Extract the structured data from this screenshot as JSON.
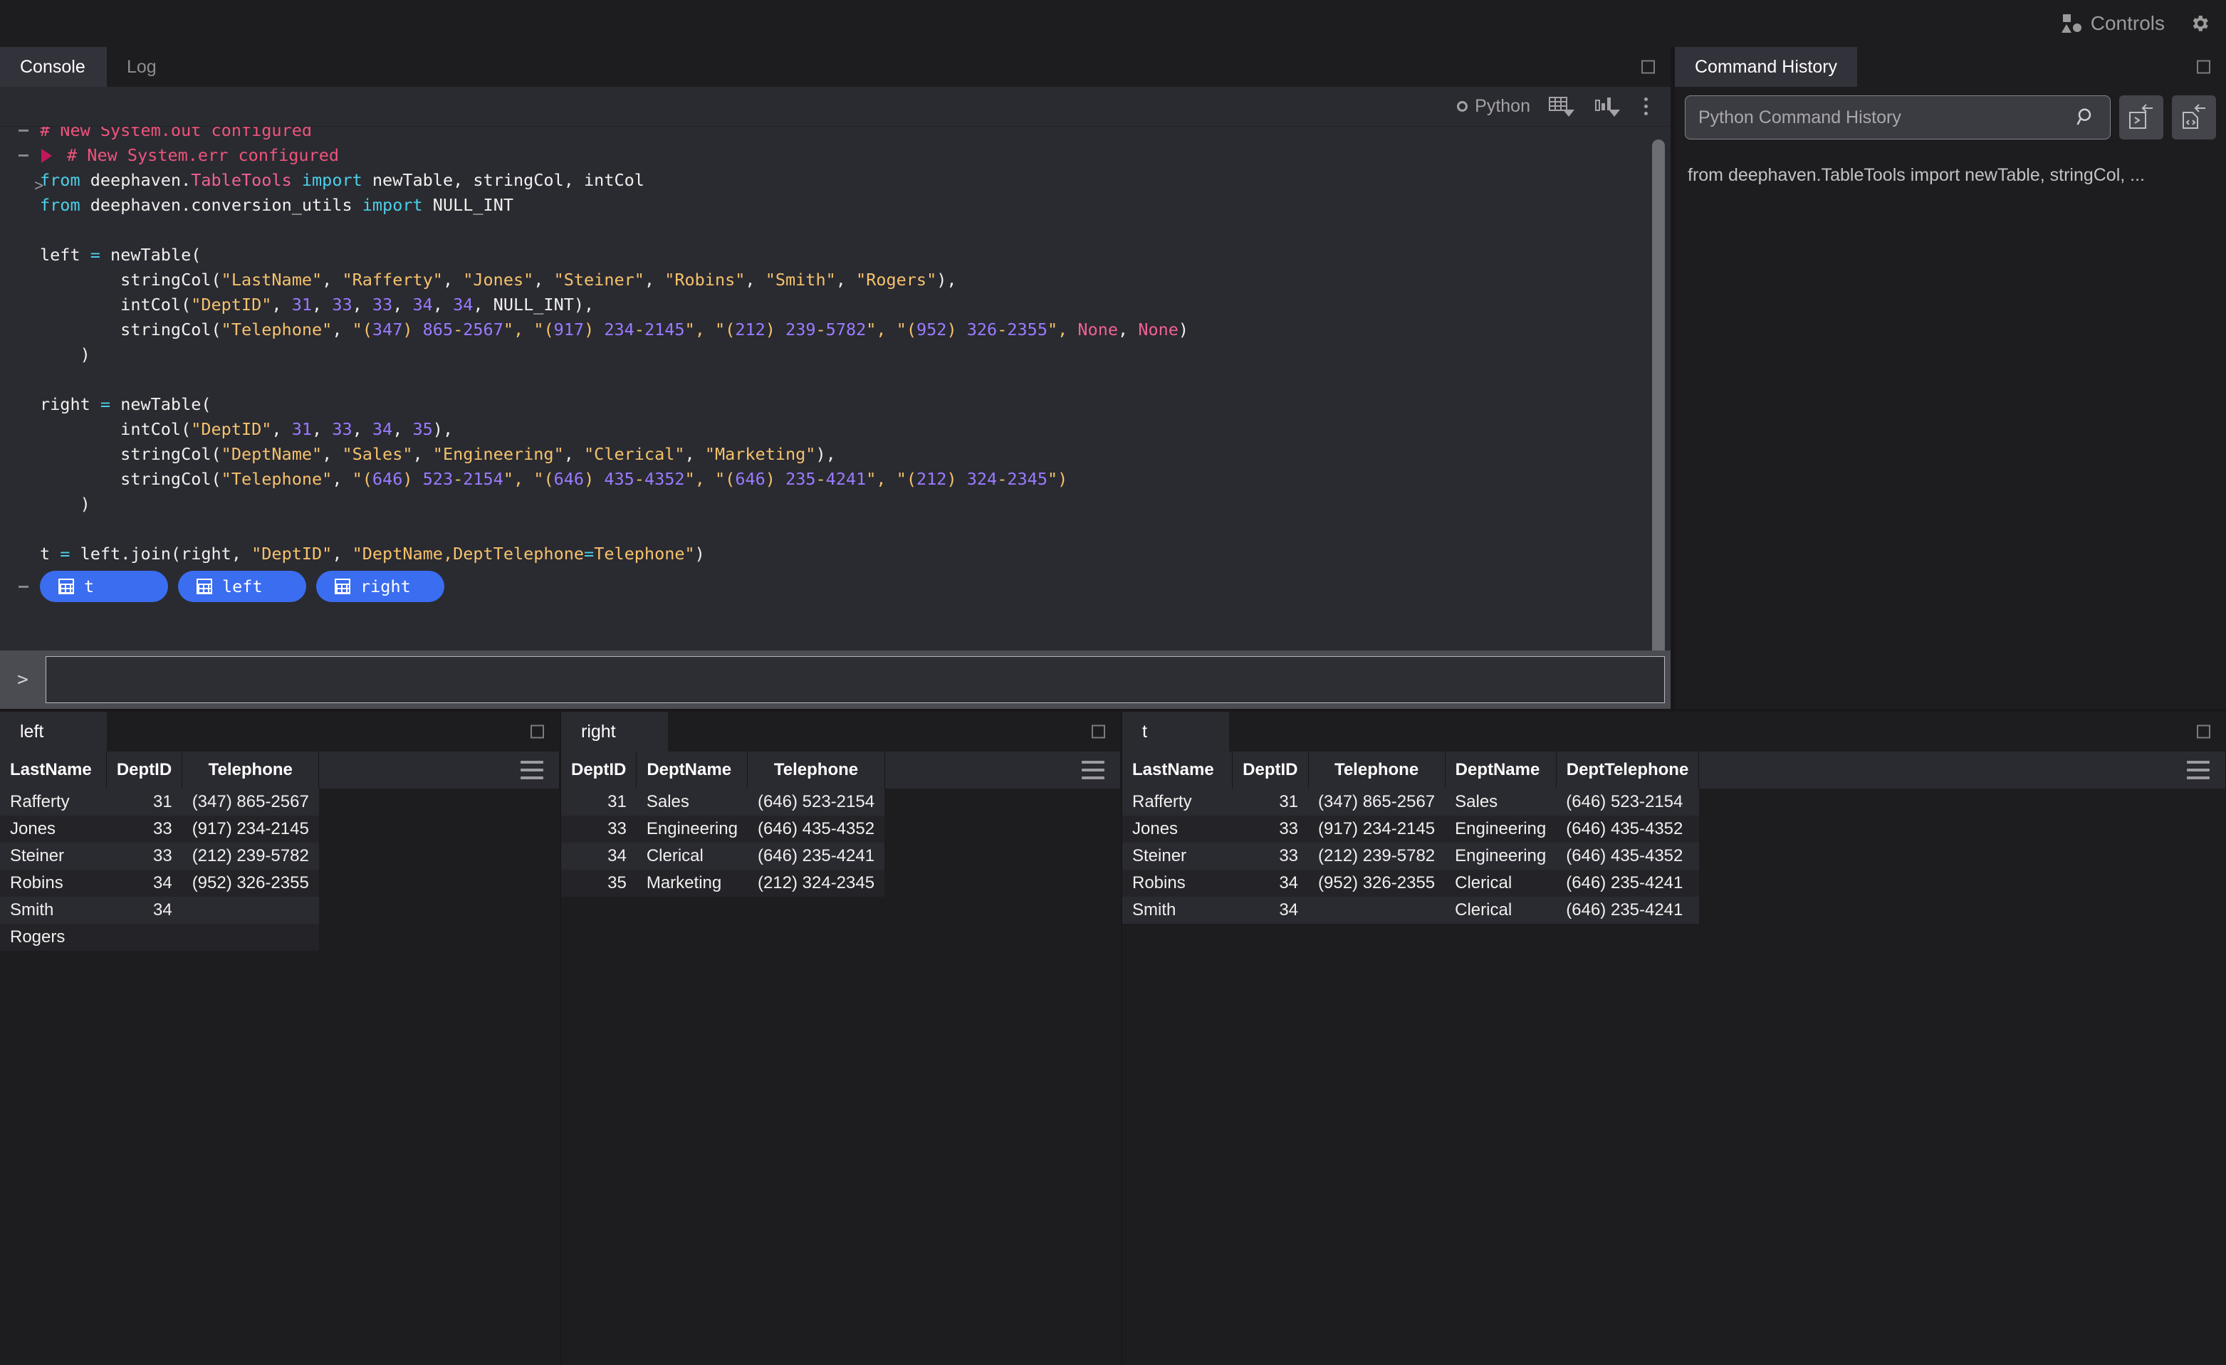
{
  "topbar": {
    "controls_label": "Controls",
    "settings_icon": "gear-icon"
  },
  "console_panel": {
    "tabs": [
      {
        "label": "Console",
        "active": true
      },
      {
        "label": "Log",
        "active": false
      }
    ],
    "toolbar": {
      "language": "Python",
      "table_icon": "table-dropdown-icon",
      "chart_icon": "chart-dropdown-icon",
      "overflow_icon": "kebab-menu-icon"
    },
    "log_lines": [
      {
        "gutter": "dash",
        "text": "# New System.out configured",
        "kind": "comment",
        "clipped": true
      },
      {
        "gutter": "dash-tri",
        "text": "# New System.err configured",
        "kind": "comment"
      },
      {
        "gutter": "chev",
        "kind": "code",
        "tokens": [
          {
            "t": "from ",
            "c": "kw"
          },
          {
            "t": "deephaven.",
            "c": "plain"
          },
          {
            "t": "TableTools",
            "c": "mod"
          },
          {
            "t": " ",
            "c": "plain"
          },
          {
            "t": "import",
            "c": "kw"
          },
          {
            "t": " newTable, stringCol, intCol",
            "c": "plain"
          }
        ]
      },
      {
        "gutter": "",
        "kind": "code",
        "tokens": [
          {
            "t": "from ",
            "c": "kw"
          },
          {
            "t": "deephaven.conversion_utils ",
            "c": "plain"
          },
          {
            "t": "import",
            "c": "kw"
          },
          {
            "t": " NULL_INT",
            "c": "plain"
          }
        ]
      },
      {
        "gutter": "",
        "kind": "blank",
        "tokens": []
      },
      {
        "gutter": "",
        "kind": "code",
        "tokens": [
          {
            "t": "left ",
            "c": "plain"
          },
          {
            "t": "=",
            "c": "op"
          },
          {
            "t": " newTable(",
            "c": "plain"
          }
        ]
      },
      {
        "gutter": "",
        "kind": "code",
        "tokens": [
          {
            "t": "        stringCol(",
            "c": "plain"
          },
          {
            "t": "\"LastName\"",
            "c": "str"
          },
          {
            "t": ", ",
            "c": "plain"
          },
          {
            "t": "\"Rafferty\"",
            "c": "str"
          },
          {
            "t": ", ",
            "c": "plain"
          },
          {
            "t": "\"Jones\"",
            "c": "str"
          },
          {
            "t": ", ",
            "c": "plain"
          },
          {
            "t": "\"Steiner\"",
            "c": "str"
          },
          {
            "t": ", ",
            "c": "plain"
          },
          {
            "t": "\"Robins\"",
            "c": "str"
          },
          {
            "t": ", ",
            "c": "plain"
          },
          {
            "t": "\"Smith\"",
            "c": "str"
          },
          {
            "t": ", ",
            "c": "plain"
          },
          {
            "t": "\"Rogers\"",
            "c": "str"
          },
          {
            "t": "),",
            "c": "plain"
          }
        ]
      },
      {
        "gutter": "",
        "kind": "code",
        "tokens": [
          {
            "t": "        intCol(",
            "c": "plain"
          },
          {
            "t": "\"DeptID\"",
            "c": "str"
          },
          {
            "t": ", ",
            "c": "plain"
          },
          {
            "t": "31",
            "c": "num"
          },
          {
            "t": ", ",
            "c": "plain"
          },
          {
            "t": "33",
            "c": "num"
          },
          {
            "t": ", ",
            "c": "plain"
          },
          {
            "t": "33",
            "c": "num"
          },
          {
            "t": ", ",
            "c": "plain"
          },
          {
            "t": "34",
            "c": "num"
          },
          {
            "t": ", ",
            "c": "plain"
          },
          {
            "t": "34",
            "c": "num"
          },
          {
            "t": ", NULL_INT),",
            "c": "plain"
          }
        ]
      },
      {
        "gutter": "",
        "kind": "code",
        "tokens": [
          {
            "t": "        stringCol(",
            "c": "plain"
          },
          {
            "t": "\"Telephone\"",
            "c": "str"
          },
          {
            "t": ", ",
            "c": "plain"
          },
          {
            "t": "\"(",
            "c": "str"
          },
          {
            "t": "347",
            "c": "num"
          },
          {
            "t": ") ",
            "c": "str"
          },
          {
            "t": "865",
            "c": "num"
          },
          {
            "t": "-",
            "c": "str"
          },
          {
            "t": "2567",
            "c": "num"
          },
          {
            "t": "\", ",
            "c": "str"
          },
          {
            "t": "\"(",
            "c": "str"
          },
          {
            "t": "917",
            "c": "num"
          },
          {
            "t": ") ",
            "c": "str"
          },
          {
            "t": "234",
            "c": "num"
          },
          {
            "t": "-",
            "c": "str"
          },
          {
            "t": "2145",
            "c": "num"
          },
          {
            "t": "\", ",
            "c": "str"
          },
          {
            "t": "\"(",
            "c": "str"
          },
          {
            "t": "212",
            "c": "num"
          },
          {
            "t": ") ",
            "c": "str"
          },
          {
            "t": "239",
            "c": "num"
          },
          {
            "t": "-",
            "c": "str"
          },
          {
            "t": "5782",
            "c": "num"
          },
          {
            "t": "\", ",
            "c": "str"
          },
          {
            "t": "\"(",
            "c": "str"
          },
          {
            "t": "952",
            "c": "num"
          },
          {
            "t": ") ",
            "c": "str"
          },
          {
            "t": "326",
            "c": "num"
          },
          {
            "t": "-",
            "c": "str"
          },
          {
            "t": "2355",
            "c": "num"
          },
          {
            "t": "\", ",
            "c": "str"
          },
          {
            "t": "None",
            "c": "none"
          },
          {
            "t": ", ",
            "c": "plain"
          },
          {
            "t": "None",
            "c": "none"
          },
          {
            "t": ")",
            "c": "plain"
          }
        ]
      },
      {
        "gutter": "",
        "kind": "code",
        "tokens": [
          {
            "t": "    )",
            "c": "plain"
          }
        ]
      },
      {
        "gutter": "",
        "kind": "blank",
        "tokens": []
      },
      {
        "gutter": "",
        "kind": "code",
        "tokens": [
          {
            "t": "right ",
            "c": "plain"
          },
          {
            "t": "=",
            "c": "op"
          },
          {
            "t": " newTable(",
            "c": "plain"
          }
        ]
      },
      {
        "gutter": "",
        "kind": "code",
        "tokens": [
          {
            "t": "        intCol(",
            "c": "plain"
          },
          {
            "t": "\"DeptID\"",
            "c": "str"
          },
          {
            "t": ", ",
            "c": "plain"
          },
          {
            "t": "31",
            "c": "num"
          },
          {
            "t": ", ",
            "c": "plain"
          },
          {
            "t": "33",
            "c": "num"
          },
          {
            "t": ", ",
            "c": "plain"
          },
          {
            "t": "34",
            "c": "num"
          },
          {
            "t": ", ",
            "c": "plain"
          },
          {
            "t": "35",
            "c": "num"
          },
          {
            "t": "),",
            "c": "plain"
          }
        ]
      },
      {
        "gutter": "",
        "kind": "code",
        "tokens": [
          {
            "t": "        stringCol(",
            "c": "plain"
          },
          {
            "t": "\"DeptName\"",
            "c": "str"
          },
          {
            "t": ", ",
            "c": "plain"
          },
          {
            "t": "\"Sales\"",
            "c": "str"
          },
          {
            "t": ", ",
            "c": "plain"
          },
          {
            "t": "\"Engineering\"",
            "c": "str"
          },
          {
            "t": ", ",
            "c": "plain"
          },
          {
            "t": "\"Clerical\"",
            "c": "str"
          },
          {
            "t": ", ",
            "c": "plain"
          },
          {
            "t": "\"Marketing\"",
            "c": "str"
          },
          {
            "t": "),",
            "c": "plain"
          }
        ]
      },
      {
        "gutter": "",
        "kind": "code",
        "tokens": [
          {
            "t": "        stringCol(",
            "c": "plain"
          },
          {
            "t": "\"Telephone\"",
            "c": "str"
          },
          {
            "t": ", ",
            "c": "plain"
          },
          {
            "t": "\"(",
            "c": "str"
          },
          {
            "t": "646",
            "c": "num"
          },
          {
            "t": ") ",
            "c": "str"
          },
          {
            "t": "523",
            "c": "num"
          },
          {
            "t": "-",
            "c": "str"
          },
          {
            "t": "2154",
            "c": "num"
          },
          {
            "t": "\", ",
            "c": "str"
          },
          {
            "t": "\"(",
            "c": "str"
          },
          {
            "t": "646",
            "c": "num"
          },
          {
            "t": ") ",
            "c": "str"
          },
          {
            "t": "435",
            "c": "num"
          },
          {
            "t": "-",
            "c": "str"
          },
          {
            "t": "4352",
            "c": "num"
          },
          {
            "t": "\", ",
            "c": "str"
          },
          {
            "t": "\"(",
            "c": "str"
          },
          {
            "t": "646",
            "c": "num"
          },
          {
            "t": ") ",
            "c": "str"
          },
          {
            "t": "235",
            "c": "num"
          },
          {
            "t": "-",
            "c": "str"
          },
          {
            "t": "4241",
            "c": "num"
          },
          {
            "t": "\", ",
            "c": "str"
          },
          {
            "t": "\"(",
            "c": "str"
          },
          {
            "t": "212",
            "c": "num"
          },
          {
            "t": ") ",
            "c": "str"
          },
          {
            "t": "324",
            "c": "num"
          },
          {
            "t": "-",
            "c": "str"
          },
          {
            "t": "2345",
            "c": "num"
          },
          {
            "t": "\")",
            "c": "str"
          }
        ]
      },
      {
        "gutter": "",
        "kind": "code",
        "tokens": [
          {
            "t": "    )",
            "c": "plain"
          }
        ]
      },
      {
        "gutter": "",
        "kind": "blank",
        "tokens": []
      },
      {
        "gutter": "",
        "kind": "code",
        "tokens": [
          {
            "t": "t ",
            "c": "plain"
          },
          {
            "t": "=",
            "c": "op"
          },
          {
            "t": " left.join(right, ",
            "c": "plain"
          },
          {
            "t": "\"DeptID\"",
            "c": "str"
          },
          {
            "t": ", ",
            "c": "plain"
          },
          {
            "t": "\"DeptName,DeptTelephone",
            "c": "str"
          },
          {
            "t": "=",
            "c": "op"
          },
          {
            "t": "Telephone\"",
            "c": "str"
          },
          {
            "t": ")",
            "c": "plain"
          }
        ]
      }
    ],
    "object_buttons": [
      {
        "label": "t",
        "icon": "table-icon"
      },
      {
        "label": "left",
        "icon": "table-icon"
      },
      {
        "label": "right",
        "icon": "table-icon"
      }
    ],
    "input": {
      "prompt": ">",
      "value": "",
      "placeholder": ""
    }
  },
  "history_panel": {
    "tab_label": "Command History",
    "search_placeholder": "Python Command History",
    "search_value": "",
    "search_icon": "magnifier-icon",
    "buttons": [
      {
        "name": "send-to-console-button",
        "icon": "console-arrow-icon"
      },
      {
        "name": "send-to-notebook-button",
        "icon": "notebook-arrow-icon"
      }
    ],
    "items": [
      "from deephaven.TableTools import newTable, stringCol, ..."
    ]
  },
  "tables": [
    {
      "panel_name": "table-panel-left",
      "tab_label": "left",
      "columns": [
        {
          "name": "LastName",
          "align": "left"
        },
        {
          "name": "DeptID",
          "align": "right"
        },
        {
          "name": "Telephone",
          "align": "center"
        }
      ],
      "rows": [
        [
          "Rafferty",
          "31",
          "(347) 865-2567"
        ],
        [
          "Jones",
          "33",
          "(917) 234-2145"
        ],
        [
          "Steiner",
          "33",
          "(212) 239-5782"
        ],
        [
          "Robins",
          "34",
          "(952) 326-2355"
        ],
        [
          "Smith",
          "34",
          ""
        ],
        [
          "Rogers",
          "",
          ""
        ]
      ]
    },
    {
      "panel_name": "table-panel-right",
      "tab_label": "right",
      "columns": [
        {
          "name": "DeptID",
          "align": "right"
        },
        {
          "name": "DeptName",
          "align": "left"
        },
        {
          "name": "Telephone",
          "align": "center"
        }
      ],
      "rows": [
        [
          "31",
          "Sales",
          "(646) 523-2154"
        ],
        [
          "33",
          "Engineering",
          "(646) 435-4352"
        ],
        [
          "34",
          "Clerical",
          "(646) 235-4241"
        ],
        [
          "35",
          "Marketing",
          "(212) 324-2345"
        ]
      ]
    },
    {
      "panel_name": "table-panel-t",
      "tab_label": "t",
      "columns": [
        {
          "name": "LastName",
          "align": "left"
        },
        {
          "name": "DeptID",
          "align": "right"
        },
        {
          "name": "Telephone",
          "align": "center"
        },
        {
          "name": "DeptName",
          "align": "left"
        },
        {
          "name": "DeptTelephone",
          "align": "center"
        }
      ],
      "rows": [
        [
          "Rafferty",
          "31",
          "(347) 865-2567",
          "Sales",
          "(646) 523-2154"
        ],
        [
          "Jones",
          "33",
          "(917) 234-2145",
          "Engineering",
          "(646) 435-4352"
        ],
        [
          "Steiner",
          "33",
          "(212) 239-5782",
          "Engineering",
          "(646) 435-4352"
        ],
        [
          "Robins",
          "34",
          "(952) 326-2355",
          "Clerical",
          "(646) 235-4241"
        ],
        [
          "Smith",
          "34",
          "",
          "Clerical",
          "(646) 235-4241"
        ]
      ]
    }
  ],
  "colors": {
    "accent_blue": "#3a6df0",
    "number_green": "#8fd14f",
    "string_yellow": "#f5c26b",
    "keyword_cyan": "#4bd0e6",
    "module_pink": "#f06292",
    "number_purple": "#9a7bff",
    "comment_red": "#f0547c",
    "panel_bg": "#2a2a31",
    "app_bg": "#1d1d20"
  }
}
